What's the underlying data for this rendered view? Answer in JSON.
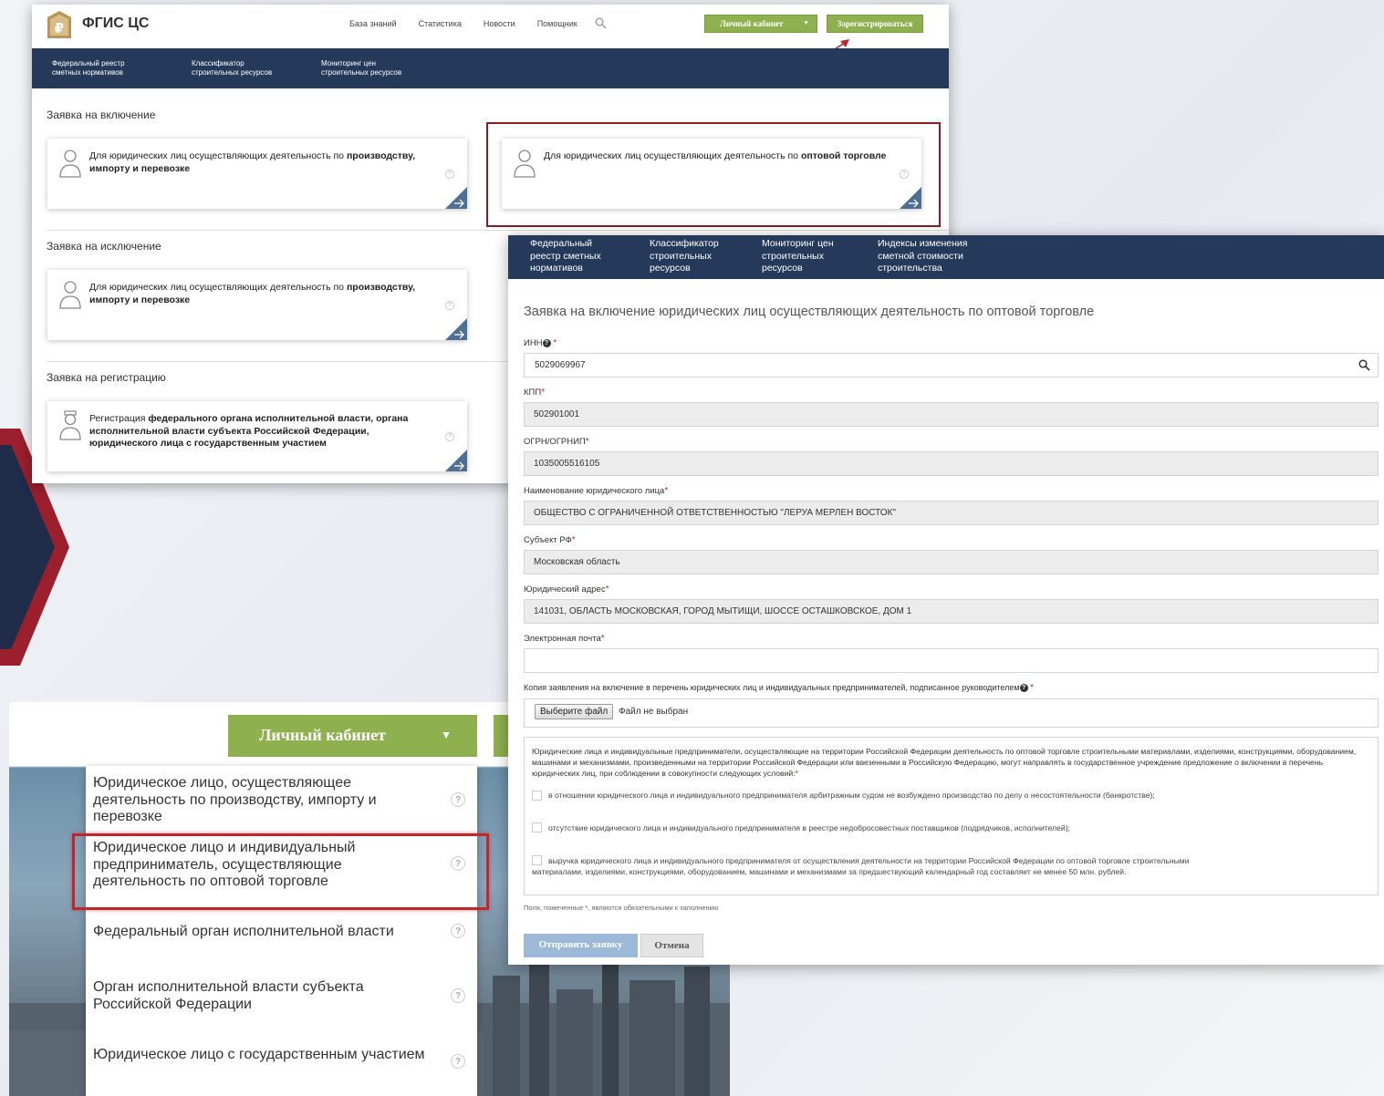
{
  "portal": {
    "brand": "ФГИС ЦС",
    "nav": [
      "База знаний",
      "Статистика",
      "Новости",
      "Помощник"
    ],
    "cabinet_label": "Личный кабинет",
    "register_label": "Зарегистрироваться",
    "menu": [
      "Федеральный реестр\nсметных нормативов",
      "Классификатор\nстроительных ресурсов",
      "Мониторинг цен\nстроительных ресурсов"
    ],
    "sections": {
      "inclusion": "Заявка на включение",
      "exclusion": "Заявка на исключение",
      "registration": "Заявка на регистрацию"
    },
    "cards": {
      "production_plain": "Для юридических лиц осуществляющих деятельность по",
      "production_bold": "производству, импорту и перевозке",
      "wholesale_plain": "Для юридических лиц осуществляющих деятельность по",
      "wholesale_bold": "оптовой торговле",
      "registration_plain": "Регистрация",
      "registration_bold": "федерального органа исполнительной власти, органа исполнительной власти субъекта Российской Федерации, юридического лица с государственным участием"
    }
  },
  "form": {
    "menu": [
      "Федеральный\nреестр сметных\nнормативов",
      "Классификатор\nстроительных\nресурсов",
      "Мониторинг цен\nстроительных\nресурсов",
      "Индексы изменения\nсметной стоимости\nстроительства"
    ],
    "title": "Заявка на включение юридических лиц осуществляющих деятельность по оптовой торговле",
    "fields": {
      "inn_label": "ИНН",
      "inn_value": "5029069967",
      "kpp_label": "КПП",
      "kpp_value": "502901001",
      "ogrn_label": "ОГРН/ОГРНИП",
      "ogrn_value": "1035005516105",
      "name_label": "Наименование юридического лица",
      "name_value": "ОБЩЕСТВО С ОГРАНИЧЕННОЙ ОТВЕТСТВЕННОСТЬЮ \"ЛЕРУА МЕРЛЕН ВОСТОК\"",
      "region_label": "Субъект РФ",
      "region_value": "Московская область",
      "address_label": "Юридический адрес",
      "address_value": "141031, ОБЛАСТЬ МОСКОВСКАЯ, ГОРОД МЫТИЩИ, ШОССЕ ОСТАШКОВСКОЕ, ДОМ 1",
      "email_label": "Электронная почта",
      "email_value": "",
      "copy_label": "Копия заявления на включение в перечень юридических лиц и индивидуальных предпринимателей, подписанное руководителем",
      "file_button": "Выберите файл",
      "file_status": "Файл не выбран"
    },
    "required_mark": "*",
    "conditions_intro": "Юридические лица и индивидуальные предприниматели, осуществляющие на территории Российской Федерации деятельность по оптовой торговле строительными материалами, изделиями, конструкциями, оборудованием, машинами и механизмами, произведенными на территории Российской Федерации или ввезенными в Российскую Федерацию, могут направлять в государственное учреждение предложение о включении в перечень юридических лиц, при соблюдении в совокупности следующих условий:",
    "conditions": [
      "в отношении юридического лица и индивидуального предпринимателя арбитражным судом не возбуждено производство по делу о несостоятельности (банкротстве);",
      "отсутствие юридического лица и индивидуального предпринимателя в реестре недобросовестных поставщиков (подрядчиков, исполнителей);",
      "выручка юридического лица и индивидуального предпринимателя от осуществления деятельности на территории Российской Федерации по оптовой торговле строительными материалами, изделиями, конструкциями, оборудованием, машинами и механизмами за предшествующий календарный год составляет не менее 50 млн. рублей."
    ],
    "conditions_checked": [
      false,
      false,
      false
    ],
    "required_note_before": "Поля, помеченные",
    "required_note_after": ", являются обязательными к заполнению",
    "submit_label": "Отправить заявку",
    "cancel_label": "Отмена"
  },
  "dropdown": {
    "cabinet_label": "Личный кабинет",
    "items": [
      "Юридическое лицо, осуществляющее деятельность по производству, импорту и перевозке",
      "Юридическое лицо и индивидуальный предприниматель, осуществляющие деятельность по оптовой торговле",
      "Федеральный орган исполнительной власти",
      "Орган исполнительной власти субъекта Российской Федерации",
      "Юридическое лицо с государственным участием"
    ],
    "help_glyph": "?"
  },
  "colors": {
    "navy": "#253a5a",
    "green": "#8fb04f",
    "highlight_red": "#c0272d",
    "frame_red": "#8b1c22"
  }
}
